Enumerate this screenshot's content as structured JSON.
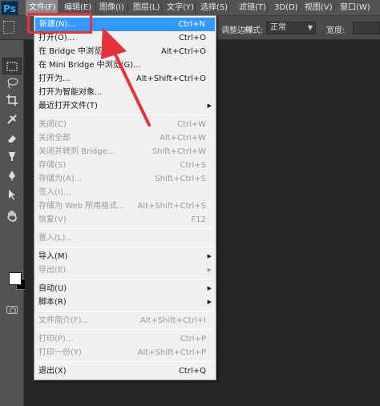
{
  "app": {
    "logo": "Ps"
  },
  "menubar": {
    "items": [
      {
        "label": "文件(F)",
        "active": true
      },
      {
        "label": "编辑(E)"
      },
      {
        "label": "图像(I)"
      },
      {
        "label": "图层(L)"
      },
      {
        "label": "文字(Y)"
      },
      {
        "label": "选择(S)"
      },
      {
        "label": "滤镜(T)"
      },
      {
        "label": "3D(D)"
      },
      {
        "label": "视图(V)"
      },
      {
        "label": "窗口(W)"
      }
    ]
  },
  "options_bar": {
    "partial_text": "调整边缘",
    "style_label": "样式:",
    "style_value": "正常",
    "width_label": "宽度:"
  },
  "file_menu": {
    "items": [
      {
        "label": "新建(N)...",
        "shortcut": "Ctrl+N",
        "highlighted": true
      },
      {
        "label": "打开(O)...",
        "shortcut": "Ctrl+O"
      },
      {
        "label": "在 Bridge 中浏览(B)...",
        "shortcut": "Alt+Ctrl+O"
      },
      {
        "label": "在 Mini Bridge 中浏览(G)..."
      },
      {
        "label": "打开为...",
        "shortcut": "Alt+Shift+Ctrl+O"
      },
      {
        "label": "打开为智能对象..."
      },
      {
        "label": "最近打开文件(T)",
        "submenu": true
      },
      {
        "separator": true
      },
      {
        "label": "关闭(C)",
        "shortcut": "Ctrl+W",
        "disabled": true
      },
      {
        "label": "关闭全部",
        "shortcut": "Alt+Ctrl+W",
        "disabled": true
      },
      {
        "label": "关闭并转到 Bridge...",
        "shortcut": "Shift+Ctrl+W",
        "disabled": true
      },
      {
        "label": "存储(S)",
        "shortcut": "Ctrl+S",
        "disabled": true
      },
      {
        "label": "存储为(A)...",
        "shortcut": "Shift+Ctrl+S",
        "disabled": true
      },
      {
        "label": "签入(I)...",
        "disabled": true
      },
      {
        "label": "存储为 Web 所用格式...",
        "shortcut": "Alt+Shift+Ctrl+S",
        "disabled": true
      },
      {
        "label": "恢复(V)",
        "shortcut": "F12",
        "disabled": true
      },
      {
        "separator": true
      },
      {
        "label": "置入(L)...",
        "disabled": true
      },
      {
        "separator": true
      },
      {
        "label": "导入(M)",
        "submenu": true
      },
      {
        "label": "导出(E)",
        "submenu": true,
        "disabled": true
      },
      {
        "separator": true
      },
      {
        "label": "自动(U)",
        "submenu": true
      },
      {
        "label": "脚本(R)",
        "submenu": true
      },
      {
        "separator": true
      },
      {
        "label": "文件简介(F)...",
        "shortcut": "Alt+Shift+Ctrl+I",
        "disabled": true
      },
      {
        "separator": true
      },
      {
        "label": "打印(P)...",
        "shortcut": "Ctrl+P",
        "disabled": true
      },
      {
        "label": "打印一份(Y)",
        "shortcut": "Alt+Shift+Ctrl+P",
        "disabled": true
      },
      {
        "separator": true
      },
      {
        "label": "退出(X)",
        "shortcut": "Ctrl+Q"
      }
    ]
  },
  "toolbox": {
    "tools": [
      "marquee-icon",
      "lasso-icon",
      "crop-icon",
      "healing-brush-icon",
      "eraser-icon",
      "smudge-icon",
      "pen-icon",
      "path-select-icon",
      "hand-icon"
    ]
  },
  "colors": {
    "highlight": "#3399ff",
    "annotation_red": "#e5323b",
    "menu_bg": "#f0f0f0"
  }
}
